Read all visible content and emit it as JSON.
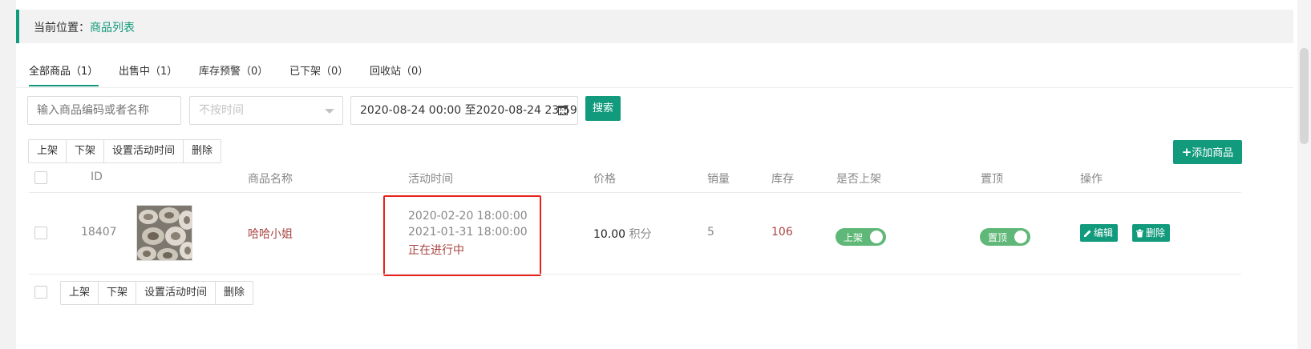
{
  "breadcrumb": {
    "label": "当前位置：",
    "current": "商品列表"
  },
  "tabs": [
    {
      "label": "全部商品（1）",
      "active": true
    },
    {
      "label": "出售中（1）",
      "active": false
    },
    {
      "label": "库存预警（0）",
      "active": false
    },
    {
      "label": "已下架（0）",
      "active": false
    },
    {
      "label": "回收站（0）",
      "active": false
    }
  ],
  "filters": {
    "search_placeholder": "输入商品编码或者名称",
    "time_select": "不按时间",
    "date_range": "2020-08-24 00:00 至2020-08-24 23:59",
    "search_button": "搜索"
  },
  "bulk_actions": {
    "on_shelf": "上架",
    "off_shelf": "下架",
    "set_time": "设置活动时间",
    "delete": "删除"
  },
  "add_button": "添加商品",
  "columns": {
    "id": "ID",
    "name": "商品名称",
    "time": "活动时间",
    "price": "价格",
    "sales": "销量",
    "stock": "库存",
    "listed": "是否上架",
    "pin": "置顶",
    "actions": "操作"
  },
  "rows": [
    {
      "id": "18407",
      "name": "哈哈小姐",
      "start": "2020-02-20 18:00:00",
      "end": "2021-01-31 18:00:00",
      "status": "正在进行中",
      "price": "10.00",
      "price_unit": "积分",
      "sales": "5",
      "stock": "106",
      "listed_label": "上架",
      "pin_label": "置顶",
      "edit_label": "编辑",
      "delete_label": "删除"
    }
  ],
  "colors": {
    "primary": "#129a7c",
    "toggle": "#5fb878",
    "danger_text": "#a94442",
    "highlight": "#e8211c"
  }
}
